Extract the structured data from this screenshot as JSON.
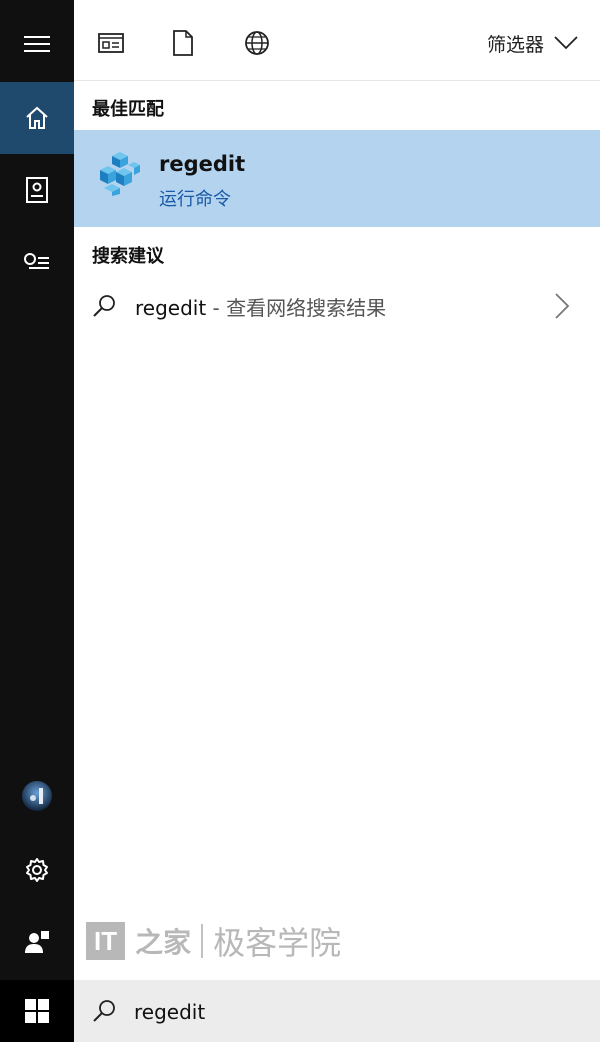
{
  "sidebar": {
    "menu_icon": "hamburger-icon",
    "items": [
      {
        "icon": "home-icon",
        "active": true
      },
      {
        "icon": "notebook-icon"
      },
      {
        "icon": "feedback-icon"
      }
    ],
    "bottom": [
      {
        "icon": "user-avatar"
      },
      {
        "icon": "gear-icon"
      },
      {
        "icon": "person-add-icon"
      }
    ]
  },
  "topbar": {
    "icons": [
      "apps-icon",
      "document-icon",
      "globe-icon"
    ],
    "filter_label": "筛选器"
  },
  "best_match": {
    "section_title": "最佳匹配",
    "title": "regedit",
    "subtitle": "运行命令",
    "icon": "registry-cubes-icon"
  },
  "suggestions": {
    "section_title": "搜索建议",
    "items": [
      {
        "term": "regedit",
        "suffix": " - 查看网络搜索结果"
      }
    ]
  },
  "watermark": {
    "brand_logo": "IT",
    "brand_mark": "之家",
    "text": "极客学院"
  },
  "search": {
    "value": "regedit"
  },
  "colors": {
    "sidebar": "#101010",
    "active": "#1f4a6e",
    "highlight": "#b3d3ee",
    "accent_text": "#1a5aa6"
  }
}
